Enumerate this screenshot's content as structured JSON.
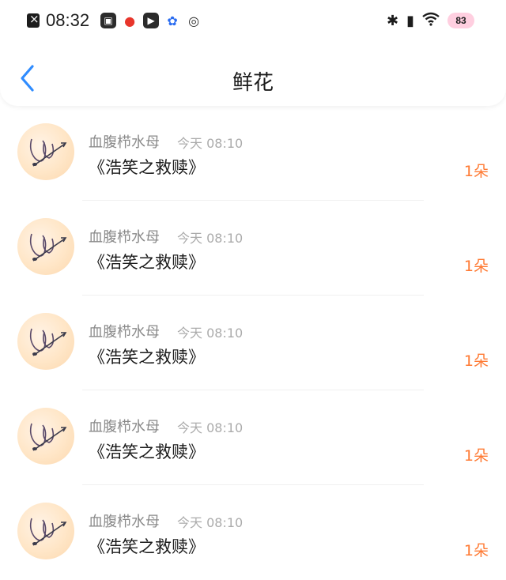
{
  "status_bar": {
    "time": "08:32",
    "battery": "83",
    "app_icons": [
      "gamepad-icon",
      "fire-app-icon",
      "play-icon",
      "paw-app-icon",
      "ring-icon"
    ],
    "right_icons": [
      "bluetooth-icon",
      "vibrate-icon",
      "wifi-icon"
    ]
  },
  "header": {
    "title": "鲜花",
    "back_icon": "chevron-left-icon"
  },
  "colors": {
    "accent": "#2f8cff",
    "count": "#ff7a33",
    "username": "#8a8a8a",
    "timestamp": "#ababab"
  },
  "items": [
    {
      "username": "血腹栉水母",
      "time": "今天  08:10",
      "title": "《浩笑之救赎》",
      "count": "1朵"
    },
    {
      "username": "血腹栉水母",
      "time": "今天  08:10",
      "title": "《浩笑之救赎》",
      "count": "1朵"
    },
    {
      "username": "血腹栉水母",
      "time": "今天  08:10",
      "title": "《浩笑之救赎》",
      "count": "1朵"
    },
    {
      "username": "血腹栉水母",
      "time": "今天  08:10",
      "title": "《浩笑之救赎》",
      "count": "1朵"
    },
    {
      "username": "血腹栉水母",
      "time": "今天  08:10",
      "title": "《浩笑之救赎》",
      "count": "1朵"
    }
  ]
}
